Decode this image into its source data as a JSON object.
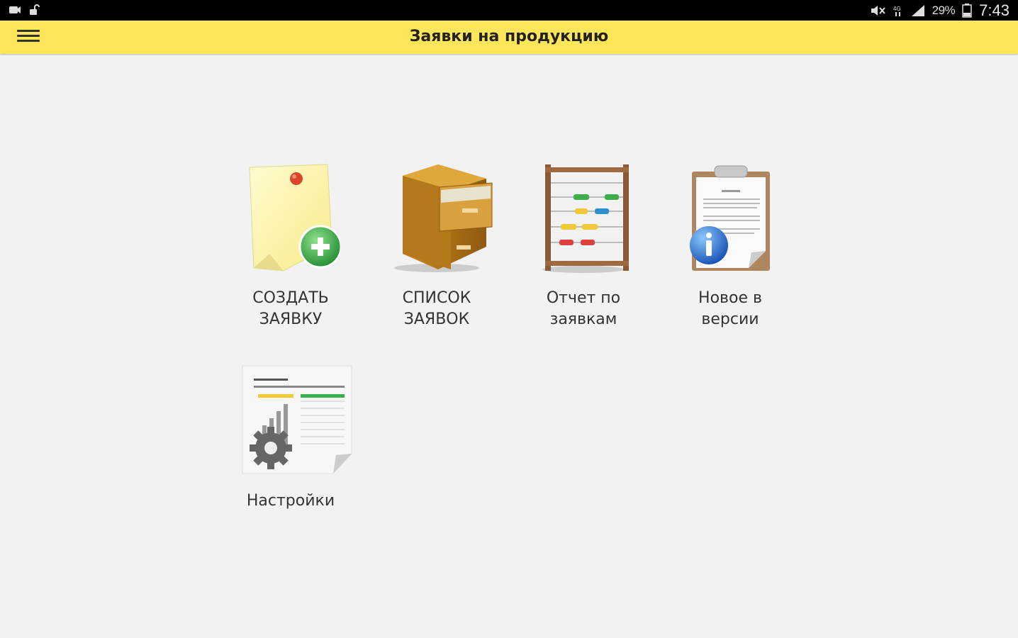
{
  "status_bar": {
    "battery": "29%",
    "time": "7:43",
    "icons": [
      "notification-icon",
      "unlock-icon",
      "mute-icon",
      "signal-4g-icon",
      "signal-bars-icon",
      "battery-icon"
    ]
  },
  "toolbar": {
    "title": "Заявки на продукцию",
    "menu_icon": "hamburger-menu-icon",
    "background_color": "#fde65a"
  },
  "tiles": [
    {
      "label_line1": "СОЗДАТЬ",
      "label_line2": "ЗАЯВКУ",
      "icon": "sticky-note-add-icon"
    },
    {
      "label_line1": "СПИСОК",
      "label_line2": "ЗАЯВОК",
      "icon": "file-cabinet-icon"
    },
    {
      "label_line1": "Отчет по",
      "label_line2": "заявкам",
      "icon": "abacus-icon"
    },
    {
      "label_line1": "Новое в",
      "label_line2": "версии",
      "icon": "clipboard-info-icon"
    },
    {
      "label_line1": "Настройки",
      "label_line2": "",
      "icon": "spreadsheet-gear-icon"
    }
  ]
}
